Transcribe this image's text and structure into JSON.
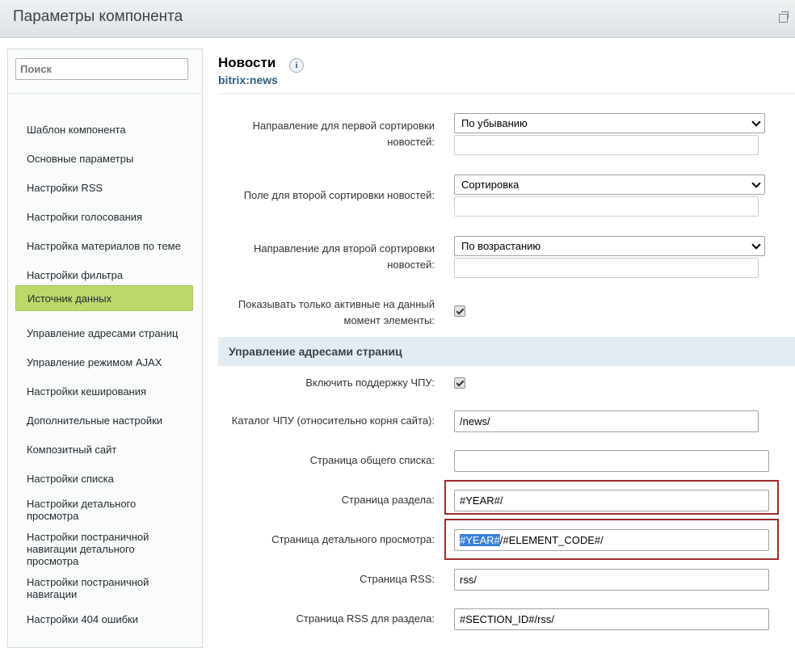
{
  "window": {
    "title": "Параметры компонента"
  },
  "sidebar": {
    "search_placeholder": "Поиск",
    "items": [
      {
        "label": "Шаблон компонента"
      },
      {
        "label": "Основные параметры"
      },
      {
        "label": "Настройки RSS"
      },
      {
        "label": "Настройки голосования"
      },
      {
        "label": "Настройка материалов по теме"
      },
      {
        "label": "Настройки фильтра"
      },
      {
        "label": "Источник данных",
        "active": true
      },
      {
        "label": "Управление адресами страниц"
      },
      {
        "label": "Управление режимом AJAX"
      },
      {
        "label": "Настройки кеширования"
      },
      {
        "label": "Дополнительные настройки"
      },
      {
        "label": "Композитный сайт"
      },
      {
        "label": "Настройки списка"
      },
      {
        "label": "Настройки детального просмотра"
      },
      {
        "label": "Настройки постраничной навигации детального просмотра"
      },
      {
        "label": "Настройки постраничной навигации"
      },
      {
        "label": "Настройки 404 ошибки"
      }
    ]
  },
  "header": {
    "title": "Новости",
    "subtitle": "bitrix:news",
    "info_icon": "info-icon"
  },
  "fields": {
    "sort1_dir": {
      "label": "Направление для первой сортировки новостей:",
      "value": "По убыванию"
    },
    "sort2_field": {
      "label": "Поле для второй сортировки новостей:",
      "value": "Сортировка"
    },
    "sort2_dir": {
      "label": "Направление для второй сортировки новостей:",
      "value": "По возрастанию"
    },
    "active_only": {
      "label": "Показывать только активные на данный момент элементы:",
      "checked": true
    }
  },
  "section": {
    "title": "Управление адресами страниц"
  },
  "sef": {
    "enable": {
      "label": "Включить поддержку ЧПУ:",
      "checked": true
    },
    "folder": {
      "label": "Каталог ЧПУ (относительно корня сайта):",
      "value": "/news/"
    },
    "list_page": {
      "label": "Страница общего списка:",
      "value": ""
    },
    "section_page": {
      "label": "Страница раздела:",
      "value": "#YEAR#/"
    },
    "detail_page": {
      "label": "Страница детального просмотра:",
      "value_selected": "#YEAR#",
      "value_rest": "/#ELEMENT_CODE#/"
    },
    "rss_page": {
      "label": "Страница RSS:",
      "value": "rss/"
    },
    "rss_section_page": {
      "label": "Страница RSS для раздела:",
      "value": "#SECTION_ID#/rss/"
    }
  },
  "colors": {
    "active_nav": "#bcd86a",
    "section_bg": "#e3ecf2",
    "highlight_box": "#9e2a2a",
    "selection": "#3a80d6"
  }
}
